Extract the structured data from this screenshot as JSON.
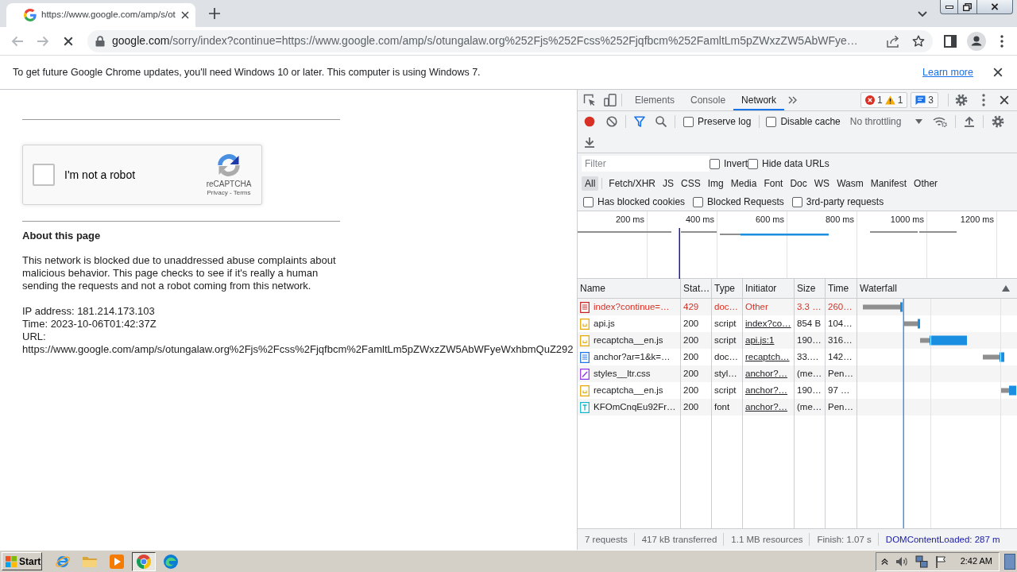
{
  "browser": {
    "tabs": [
      {
        "title": "https://www.google.com/amp/s/ot",
        "selected": true
      }
    ],
    "address_bar": {
      "host": "google.com",
      "path": "/sorry/index?continue=https://www.google.com/amp/s/otungalaw.org%252Fjs%252Fcss%252Fjqfbcm%252FamltLm5pZWxzZW5AbWFye…"
    },
    "infobar": {
      "message": "To get future Google Chrome updates, you'll need Windows 10 or later. This computer is using Windows 7.",
      "link": "Learn more"
    }
  },
  "page": {
    "captcha": {
      "label": "I'm not a robot",
      "checked": false,
      "brand": "reCAPTCHA",
      "legal": "Privacy - Terms"
    },
    "heading": "About this page",
    "paragraph": "This network is blocked due to unaddressed abuse complaints about malicious behavior. This page checks to see if it's really a human sending the requests and not a robot coming from this network.",
    "details": [
      "IP address: 181.214.173.103",
      "Time: 2023-10-06T01:42:37Z",
      "URL:",
      "https://www.google.com/amp/s/otungalaw.org%2Fjs%2Fcss%2Fjqfbcm%2FamltLm5pZWxzZW5AbWFyeWxhbmQuZ292"
    ]
  },
  "devtools": {
    "tabs": [
      {
        "label": "Elements",
        "selected": false
      },
      {
        "label": "Console",
        "selected": false
      },
      {
        "label": "Network",
        "selected": true
      }
    ],
    "issue_counters": [
      {
        "kind": "error",
        "count": "1"
      },
      {
        "kind": "warning",
        "count": "1"
      }
    ],
    "message_counter": "3",
    "toolbar": {
      "recording": true,
      "options": [
        {
          "label": "Preserve log",
          "checked": false
        },
        {
          "label": "Disable cache",
          "checked": false
        }
      ],
      "throttling": "No throttling"
    },
    "filter": {
      "placeholder": "Filter",
      "options": [
        {
          "label": "Invert",
          "checked": false
        },
        {
          "label": "Hide data URLs",
          "checked": false
        }
      ]
    },
    "types": [
      {
        "label": "All",
        "selected": true
      },
      {
        "label": "Fetch/XHR",
        "selected": false
      },
      {
        "label": "JS",
        "selected": false
      },
      {
        "label": "CSS",
        "selected": false
      },
      {
        "label": "Img",
        "selected": false
      },
      {
        "label": "Media",
        "selected": false
      },
      {
        "label": "Font",
        "selected": false
      },
      {
        "label": "Doc",
        "selected": false
      },
      {
        "label": "WS",
        "selected": false
      },
      {
        "label": "Wasm",
        "selected": false
      },
      {
        "label": "Manifest",
        "selected": false
      },
      {
        "label": "Other",
        "selected": false
      }
    ],
    "more_filters": [
      {
        "label": "Has blocked cookies",
        "checked": false
      },
      {
        "label": "Blocked Requests",
        "checked": false
      },
      {
        "label": "3rd-party requests",
        "checked": false
      }
    ],
    "overview": {
      "ticks": [
        "200 ms",
        "400 ms",
        "600 ms",
        "800 ms",
        "1000 ms",
        "1200 ms"
      ]
    },
    "table": {
      "columns": [
        "Name",
        "Stat…",
        "Type",
        "Initiator",
        "Size",
        "Time",
        "Waterfall"
      ],
      "rows": [
        {
          "kind": "document",
          "error": true,
          "name": "index?continue=…",
          "status": "429",
          "type": "doc…",
          "initiator": "Other",
          "initiator_link": false,
          "size": "3.3 …",
          "time": "260…"
        },
        {
          "kind": "script",
          "error": false,
          "name": "api.js",
          "status": "200",
          "type": "script",
          "initiator": "index?co…",
          "initiator_link": true,
          "size": "854 B",
          "time": "104…"
        },
        {
          "kind": "script",
          "error": false,
          "name": "recaptcha__en.js",
          "status": "200",
          "type": "script",
          "initiator": "api.js:1",
          "initiator_link": true,
          "size": "190…",
          "time": "316…"
        },
        {
          "kind": "document",
          "error": false,
          "name": "anchor?ar=1&k=…",
          "status": "200",
          "type": "doc…",
          "initiator": "recaptch…",
          "initiator_link": true,
          "size": "33.…",
          "time": "142…"
        },
        {
          "kind": "stylesheet",
          "error": false,
          "name": "styles__ltr.css",
          "status": "200",
          "type": "styl…",
          "initiator": "anchor?…",
          "initiator_link": true,
          "size": "(me…",
          "time": "Pen…"
        },
        {
          "kind": "script",
          "error": false,
          "name": "recaptcha__en.js",
          "status": "200",
          "type": "script",
          "initiator": "anchor?…",
          "initiator_link": true,
          "size": "190…",
          "time": "97 …"
        },
        {
          "kind": "font",
          "error": false,
          "name": "KFOmCnqEu92Fr…",
          "status": "200",
          "type": "font",
          "initiator": "anchor?…",
          "initiator_link": true,
          "size": "(me…",
          "time": "Pen…"
        }
      ]
    },
    "status_bar": [
      {
        "kind": "summary",
        "text": "7 requests"
      },
      {
        "kind": "summary",
        "text": "417 kB transferred"
      },
      {
        "kind": "summary",
        "text": "1.1 MB resources"
      },
      {
        "kind": "summary",
        "text": "Finish: 1.07 s"
      },
      {
        "kind": "dom_loaded",
        "text": "DOMContentLoaded: 287 m"
      }
    ]
  },
  "taskbar": {
    "start": "Start",
    "apps": [
      {
        "kind": "ie",
        "selected": false
      },
      {
        "kind": "explorer",
        "selected": false
      },
      {
        "kind": "media",
        "selected": false
      },
      {
        "kind": "chrome",
        "selected": true
      },
      {
        "kind": "edge",
        "selected": false
      }
    ],
    "clock": "2:42 AM"
  }
}
